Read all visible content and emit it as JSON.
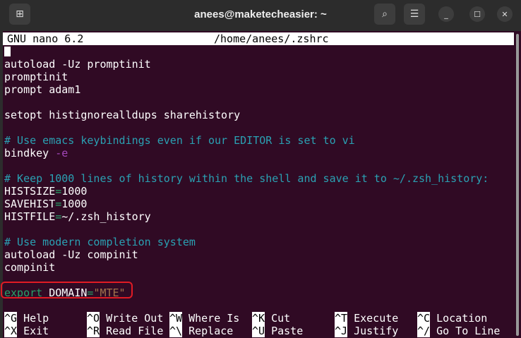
{
  "window": {
    "title": "anees@maketecheasier: ~"
  },
  "nano": {
    "version": "GNU nano 6.2",
    "filename": "/home/anees/.zshrc"
  },
  "colors": {
    "bg": "#300a24",
    "text": "#ffffff",
    "comment": "#2aa1b3",
    "operator": "#26a269",
    "flag": "#a347ba",
    "string": "#a2734c",
    "highlight": "#e01b24"
  },
  "lines": [
    [
      {
        "t": "autoload -Uz promptinit",
        "c": "text"
      }
    ],
    [
      {
        "t": "promptinit",
        "c": "text"
      }
    ],
    [
      {
        "t": "prompt adam1",
        "c": "text"
      }
    ],
    [],
    [
      {
        "t": "setopt histignorealldups sharehistory",
        "c": "text"
      }
    ],
    [],
    [
      {
        "t": "# Use emacs keybindings even if our EDITOR is set to vi",
        "c": "comment"
      }
    ],
    [
      {
        "t": "bindkey ",
        "c": "text"
      },
      {
        "t": "-e",
        "c": "flag"
      }
    ],
    [],
    [
      {
        "t": "# Keep 1000 lines of history within the shell and save it to ~/.zsh_history:",
        "c": "comment"
      }
    ],
    [
      {
        "t": "HISTSIZE",
        "c": "text"
      },
      {
        "t": "=",
        "c": "operator"
      },
      {
        "t": "1000",
        "c": "text"
      }
    ],
    [
      {
        "t": "SAVEHIST",
        "c": "text"
      },
      {
        "t": "=",
        "c": "operator"
      },
      {
        "t": "1000",
        "c": "text"
      }
    ],
    [
      {
        "t": "HISTFILE",
        "c": "text"
      },
      {
        "t": "=",
        "c": "operator"
      },
      {
        "t": "~/.zsh_history",
        "c": "text"
      }
    ],
    [],
    [
      {
        "t": "# Use modern completion system",
        "c": "comment"
      }
    ],
    [
      {
        "t": "autoload -Uz compinit",
        "c": "text"
      }
    ],
    [
      {
        "t": "compinit",
        "c": "text"
      }
    ],
    [],
    [
      {
        "t": "export",
        "c": "operator"
      },
      {
        "t": " DOMAIN",
        "c": "text"
      },
      {
        "t": "=",
        "c": "operator"
      },
      {
        "t": "\"MTE\"",
        "c": "string"
      }
    ]
  ],
  "shortcuts": [
    [
      {
        "key": "^G",
        "label": "Help"
      },
      {
        "key": "^O",
        "label": "Write Out"
      },
      {
        "key": "^W",
        "label": "Where Is"
      },
      {
        "key": "^K",
        "label": "Cut"
      },
      {
        "key": "^T",
        "label": "Execute"
      },
      {
        "key": "^C",
        "label": "Location"
      }
    ],
    [
      {
        "key": "^X",
        "label": "Exit"
      },
      {
        "key": "^R",
        "label": "Read File"
      },
      {
        "key": "^\\",
        "label": "Replace"
      },
      {
        "key": "^U",
        "label": "Paste"
      },
      {
        "key": "^J",
        "label": "Justify"
      },
      {
        "key": "^/",
        "label": "Go To Line"
      }
    ]
  ]
}
